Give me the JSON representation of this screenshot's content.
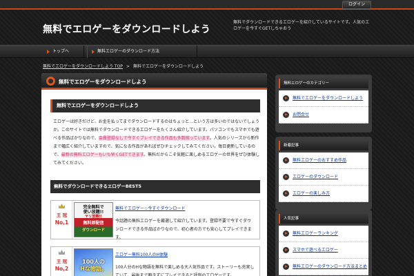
{
  "top_button": "ログイン",
  "site": {
    "title": "無料でエロゲーをダウンロードしよう",
    "description": "無料でダウンロードできるエロゲーを紹介しているサイトです。人気のエロゲーを今すぐGETしちゃおう"
  },
  "gnav": [
    "トップへ",
    "無料エロゲーのダウンロード方法"
  ],
  "breadcrumb": {
    "home": "無料でエロゲーをダウンロードしよう TOP",
    "sep": ">",
    "current": "無料でエロゲーをダウンロードしよう"
  },
  "main": {
    "title": "無料でエロゲーをダウンロードしよう",
    "article_heading": "無料でエロゲーをダウンロードしよう",
    "body": {
      "p1": "エロゲーは好きだけど、お金を払ってまでダウンロードするのはちょっと…という方は多いのではないでしょうか。このサイトでは無料でダウンロードできるエロゲーをたくさん紹介しています。パソコンでもスマホでも遊べる作品ばかりなので、",
      "hl1": "会員登録なしで今すぐプレイできる作品も多数揃っています",
      "p2": "。人気のシリーズから新作まで幅広く紹介していますので、気になる作品があればぜひチェックしてみてください。毎日更新しているので、",
      "hl2": "最新の無料エロゲーもいち早くGETできます",
      "p3": "。無料だからこそ気軽に楽しめるエロゲーの世界をぜひ体験してみてください。"
    },
    "ranking_heading": "無料でダウンロードできるエロゲーBEST5",
    "ranks": [
      {
        "mark": "王 冠",
        "no": "No,1",
        "title": "無料でエロゲー☆今すぐダウンロード",
        "desc": "今話題の無料エロゲーを厳選して紹介しています。登録不要で今すぐダウンロードできる作品ばかりなので、初心者の方でも安心してプレイできます。",
        "thumb_lines": [
          "完全無料で",
          "使い放題!!",
          "ヤリ放題!!",
          "無料即配信",
          "ダウンロード"
        ]
      },
      {
        "mark": "王 冠",
        "no": "No,2",
        "title": "エロゲー無料100人のH体験",
        "desc": "100人分のHな物語を無料で楽しめる大人気作品です。ストーリーも充実していて、最後まで飽きずにプレイできると評判のエロゲーです。",
        "thumb_lines": [
          "100人の",
          "Hな物語。"
        ]
      }
    ]
  },
  "sidebar": [
    {
      "title": "無料エロゲーのカテゴリー",
      "items": [
        "無料でエロゲーをダウンロードしよう",
        "お問合せ"
      ]
    },
    {
      "title": "新着記事",
      "items": [
        "無料エロゲーのおすすめ作品",
        "エロゲーのダウンロード",
        "エロゲーの楽しみ方"
      ]
    },
    {
      "title": "人気記事",
      "items": [
        "無料エロゲーランキング",
        "スマホで遊べるエロゲー",
        "無料エロゲーのダウンロード方法まとめ"
      ]
    }
  ],
  "colors": {
    "accent": "#d8541f",
    "link": "#0033aa",
    "highlight": "#e0286a",
    "header_bg": "#1b1b1b"
  }
}
